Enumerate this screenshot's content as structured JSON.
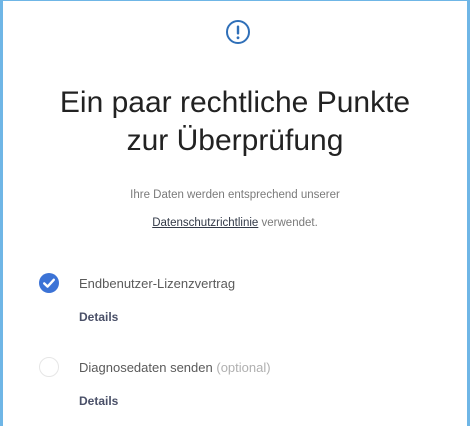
{
  "header": {
    "icon": "info-icon",
    "title_line1": "Ein paar rechtliche Punkte",
    "title_line2": "zur Überprüfung"
  },
  "intro": {
    "text_line1": "Ihre Daten werden entsprechend unserer",
    "link": "Datenschutzrichtlinie",
    "text_after_link": " verwendet."
  },
  "items": [
    {
      "label": "Endbenutzer-Lizenzvertrag",
      "checked": true,
      "details_label": "Details"
    },
    {
      "label": "Diagnosedaten senden",
      "optional_label": "(optional)",
      "checked": false,
      "details_label": "Details"
    }
  ],
  "colors": {
    "accent": "#3c73d6",
    "frame": "#6fb6e6",
    "icon": "#2f6fb8"
  }
}
